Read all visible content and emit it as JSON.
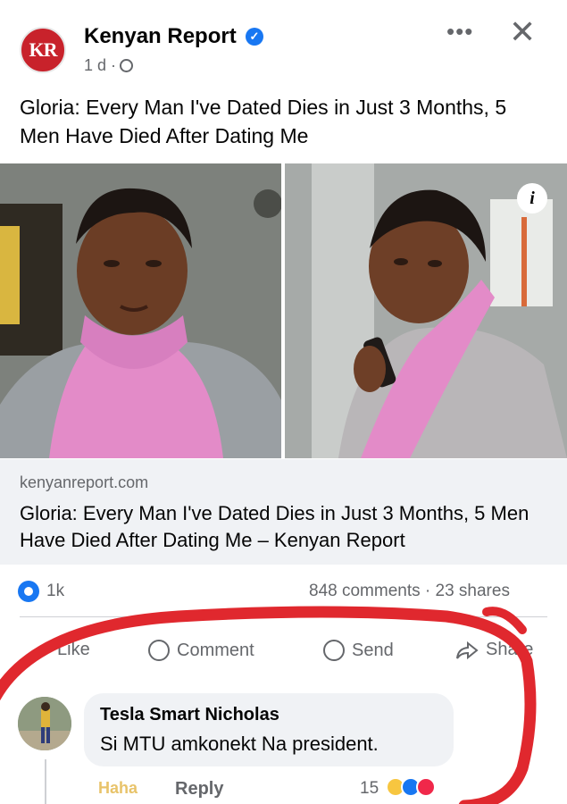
{
  "post": {
    "page_name": "Kenyan Report",
    "avatar_text": "KR",
    "time": "1 d ·",
    "more_icon": "more-dots-icon",
    "caption": "Gloria: Every Man I've Dated Dies in Just 3 Months, 5 Men Have Died After Dating Me",
    "link_domain": "kenyanreport.com",
    "link_title": "Gloria: Every Man I've Dated Dies in Just 3 Months, 5 Men Have Died After Dating Me – Kenyan Report",
    "info_badge": "i"
  },
  "stats": {
    "reactions": "1k",
    "comments_shares": "848 comments · 23 shares"
  },
  "actions": {
    "like": "Like",
    "comment": "Comment",
    "send": "Send",
    "share": "Share"
  },
  "comment": {
    "author": "Tesla Smart Nicholas",
    "text": "Si MTU amkonekt Na president.",
    "haha": "Haha",
    "reply": "Reply",
    "reaction_count": "15"
  },
  "colors": {
    "brand_blue": "#1877f2",
    "annotation_red": "#e0282e",
    "scarf_pink": "#e38bc8"
  }
}
